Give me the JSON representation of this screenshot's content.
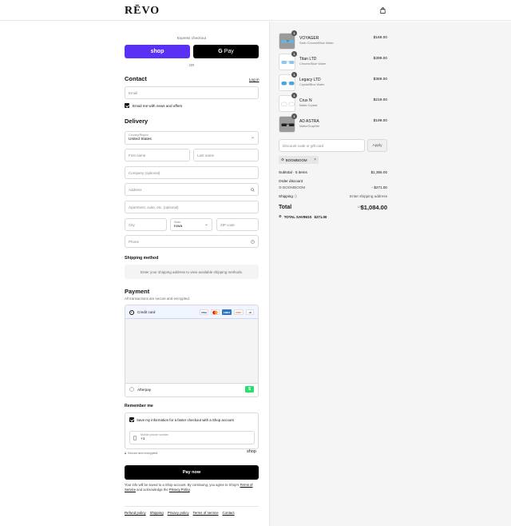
{
  "header": {
    "logo": "RĒVO",
    "cart_icon": "shopping-bag-icon"
  },
  "express": {
    "label": "Express checkout",
    "shop_label": "shop",
    "gpay_g": "G",
    "gpay_label": "Pay",
    "or": "OR"
  },
  "contact": {
    "title": "Contact",
    "login": "Log in",
    "email_placeholder": "Email",
    "news_label": "Email me with news and offers"
  },
  "delivery": {
    "title": "Delivery",
    "country_label": "Country/Region",
    "country_value": "United States",
    "first_name": "First name",
    "last_name": "Last name",
    "company": "Company (optional)",
    "address": "Address",
    "apartment": "Apartment, suite, etc. (optional)",
    "city": "City",
    "state_label": "State",
    "state_value": "Iowa",
    "zip": "ZIP code",
    "phone": "Phone"
  },
  "shipping": {
    "title": "Shipping method",
    "info": "Enter your shipping address to view available shipping methods."
  },
  "payment": {
    "title": "Payment",
    "subtitle": "All transactions are secure and encrypted.",
    "credit_card": "Credit card",
    "cards": [
      "VISA",
      "MC",
      "AMEX",
      "DISC"
    ],
    "more_cards": "+6",
    "afterpay": "Afterpay",
    "afterpay_badge": "$"
  },
  "remember": {
    "title": "Remember me",
    "save_label": "Save my information for a faster checkout with a Shop account",
    "mobile_label": "Mobile phone number",
    "mobile_value": "+1",
    "secure": "Secure and encrypted",
    "shop": "shop"
  },
  "pay_now": "Pay now",
  "fine_print": {
    "text1": "Your info will be saved to a Shop account. By continuing, you agree to Shop's",
    "terms": "Terms of Service",
    "text2": "and acknowledge the",
    "privacy": "Privacy Policy",
    "end": "."
  },
  "footer": [
    "Refund policy",
    "Shipping",
    "Privacy policy",
    "Terms of service",
    "Contact"
  ],
  "summary": {
    "items": [
      {
        "name": "VOYAGER",
        "variant": "Satin Chrome/Blue Water",
        "price": "$169.00",
        "qty": "1"
      },
      {
        "name": "Titan LTD",
        "variant": "Chrome/Blue Water",
        "price": "$399.00",
        "qty": "1"
      },
      {
        "name": "Legacy LTD",
        "variant": "Crystal/Blue Water",
        "price": "$369.00",
        "qty": "1"
      },
      {
        "name": "Crux N",
        "variant": "Matte Crystal",
        "price": "$219.00",
        "qty": "1"
      },
      {
        "name": "AD ASTRA",
        "variant": "Matte/Graphite",
        "price": "$199.00",
        "qty": "1"
      }
    ],
    "discount_placeholder": "Discount code or gift card",
    "apply": "Apply",
    "code": "BOOMBOOM",
    "subtotal_label": "Subtotal · 5 items",
    "subtotal": "$1,355.00",
    "order_discount": "Order discount",
    "discount_code": "BOOMBOOM",
    "discount_value": "- $271.00",
    "shipping_label": "Shipping",
    "shipping_value": "Enter shipping address",
    "total_label": "Total",
    "currency": "USD",
    "total": "$1,084.00",
    "savings_label": "TOTAL SAVINGS",
    "savings_value": "$271.00"
  }
}
